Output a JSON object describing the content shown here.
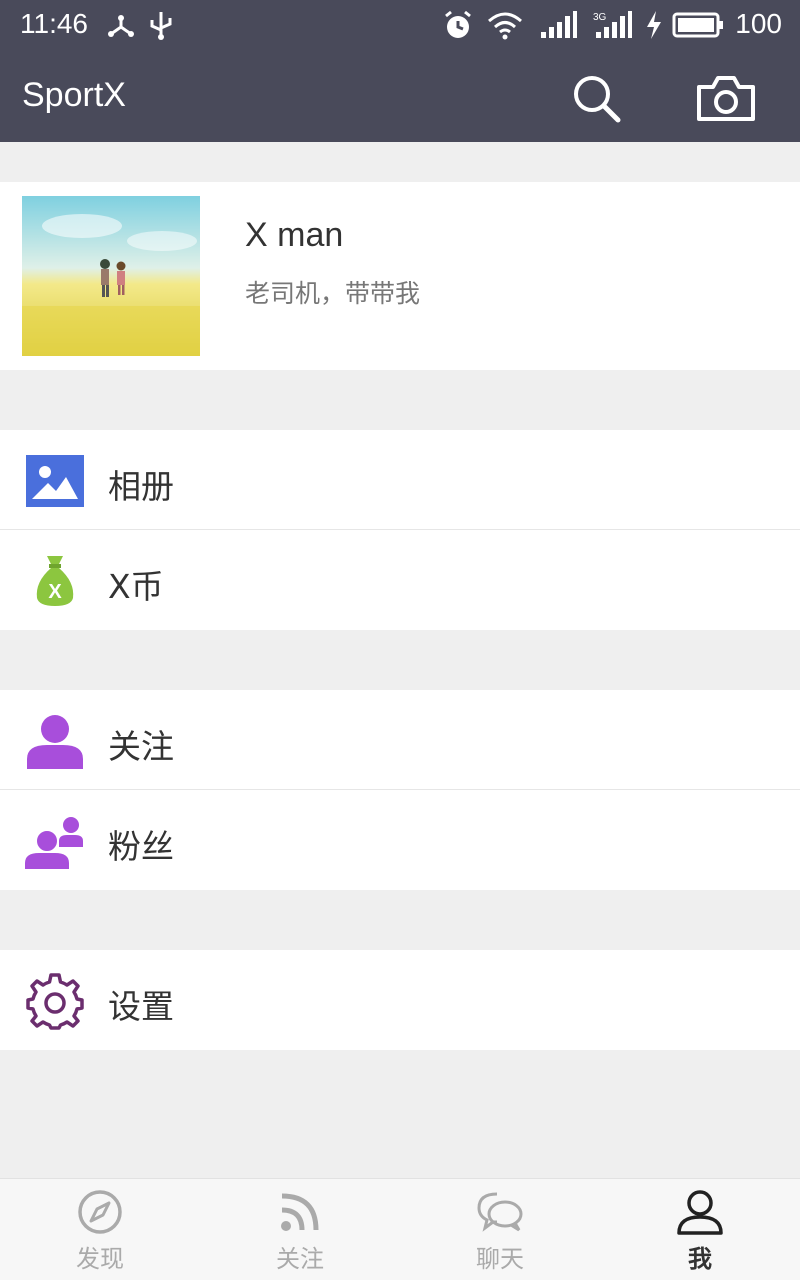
{
  "status_bar": {
    "time": "11:46",
    "battery_percent": "100",
    "network": "3G"
  },
  "app_bar": {
    "title": "SportX",
    "icons": [
      "search-icon",
      "camera-icon"
    ]
  },
  "profile": {
    "name": "X man",
    "signature": "老司机，带带我"
  },
  "menu_groups": [
    [
      {
        "label": "相册",
        "icon": "album-icon",
        "color": "#4a6fdc"
      },
      {
        "label": "X币",
        "icon": "money-bag-icon",
        "color": "#8cc63f"
      }
    ],
    [
      {
        "label": "关注",
        "icon": "user-icon",
        "color": "#a84edb"
      },
      {
        "label": "粉丝",
        "icon": "fans-icon",
        "color": "#a84edb"
      }
    ],
    [
      {
        "label": "设置",
        "icon": "gear-icon",
        "color": "#6b2e6e"
      }
    ]
  ],
  "tabs": [
    {
      "label": "发现",
      "icon": "compass-icon",
      "active": false
    },
    {
      "label": "关注",
      "icon": "rss-icon",
      "active": false
    },
    {
      "label": "聊天",
      "icon": "chat-icon",
      "active": false
    },
    {
      "label": "我",
      "icon": "person-icon",
      "active": true
    }
  ],
  "colors": {
    "header_bg": "#494a5a",
    "page_bg": "#efefef",
    "tab_inactive": "#aaaaaa",
    "tab_active": "#333333"
  }
}
